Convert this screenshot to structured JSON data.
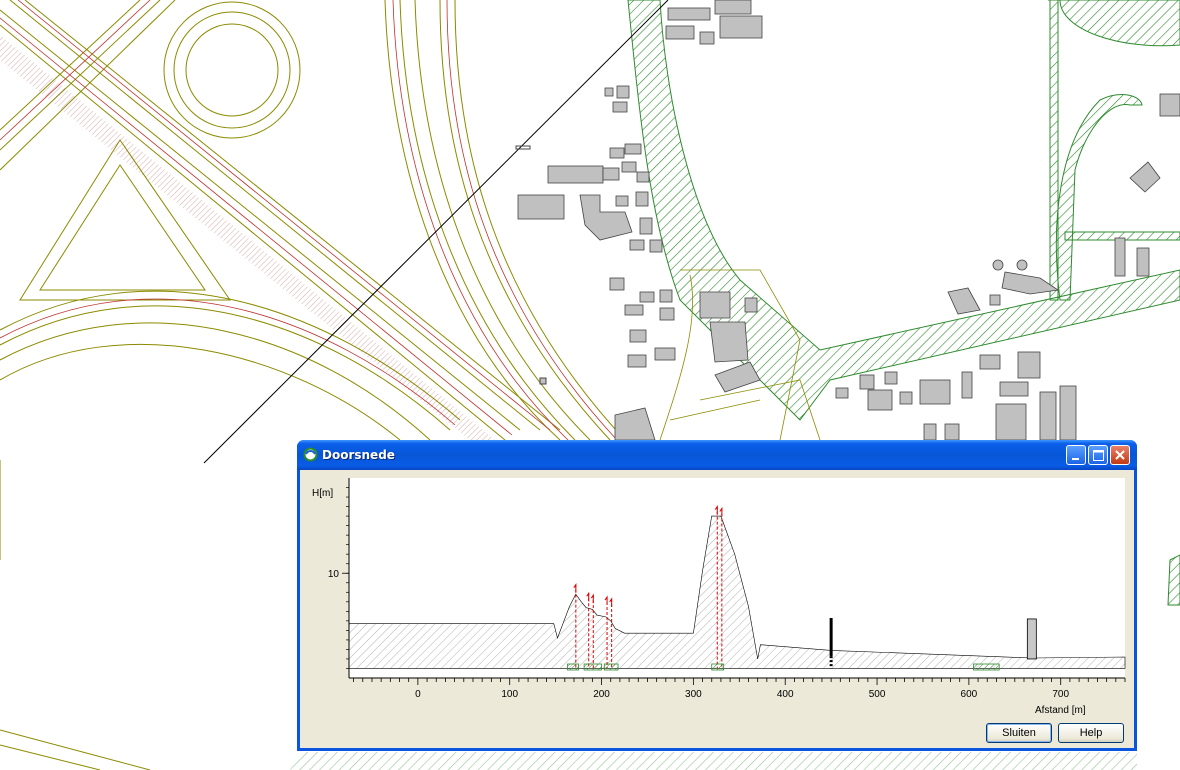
{
  "window": {
    "title": "Doorsnede",
    "buttons": {
      "close_label": "Sluiten",
      "help_label": "Help"
    }
  },
  "icons": [
    "app-icon",
    "minimize-icon",
    "maximize-icon",
    "close-icon"
  ],
  "colors": {
    "titlebar": "#0a55e0",
    "road_lines": "#8b8b00",
    "vegetation": "#2e8b2e",
    "buildings": "#c0c0c0",
    "obstacle_red": "#e00000"
  },
  "chart_data": {
    "type": "area",
    "title": "",
    "ylabel": "H[m]",
    "xlabel": "Afstand [m]",
    "xlim": [
      -75,
      770
    ],
    "ylim": [
      -1,
      20
    ],
    "x_ticks": [
      0,
      100,
      200,
      300,
      400,
      500,
      600,
      700
    ],
    "y_ticks": [
      10
    ],
    "series": [
      {
        "x": [
          -75,
          148,
          152,
          165,
          172,
          178,
          183,
          190,
          195,
          205,
          210,
          215,
          225,
          225,
          300,
          310,
          320,
          330,
          345,
          360,
          370,
          373,
          450,
          670,
          770
        ],
        "y": [
          4.7,
          4.7,
          3.2,
          6.5,
          7.8,
          7.0,
          6.4,
          6.2,
          5.6,
          5.4,
          5.0,
          4.2,
          3.7,
          3.7,
          3.7,
          10.3,
          16.0,
          16.0,
          12.0,
          6.5,
          1.0,
          2.5,
          1.9,
          1.1,
          1.2
        ]
      }
    ],
    "obstacles": [
      {
        "x": 172,
        "height": 8.8
      },
      {
        "x": 186,
        "height": 7.9
      },
      {
        "x": 191,
        "height": 7.7
      },
      {
        "x": 206,
        "height": 7.5
      },
      {
        "x": 211,
        "height": 7.3
      },
      {
        "x": 326,
        "height": 17.0
      },
      {
        "x": 331,
        "height": 16.8
      }
    ],
    "markers": [
      {
        "type": "receiver",
        "x": 450,
        "height": 5.3
      },
      {
        "type": "building",
        "x": 668,
        "height": 5.2
      }
    ],
    "ground_segments": [
      [
        163,
        175
      ],
      [
        181,
        200
      ],
      [
        203,
        218
      ],
      [
        320,
        333
      ],
      [
        605,
        633
      ]
    ]
  }
}
